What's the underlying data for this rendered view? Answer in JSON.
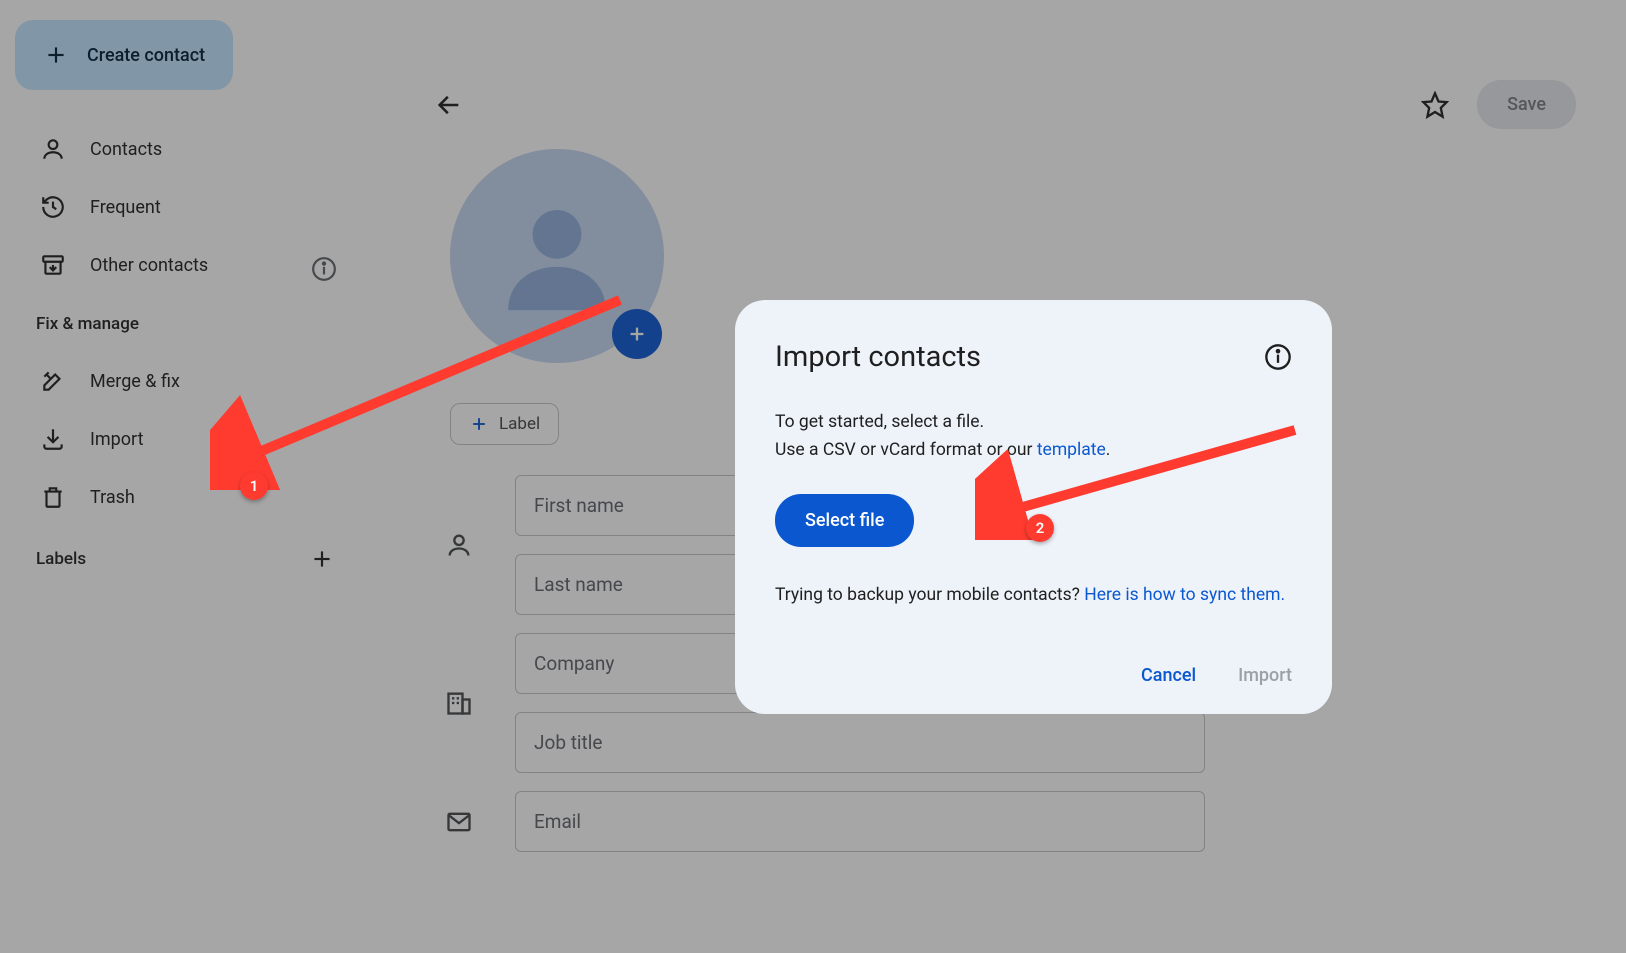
{
  "sidebar": {
    "create_label": "Create contact",
    "items": [
      {
        "label": "Contacts"
      },
      {
        "label": "Frequent"
      },
      {
        "label": "Other contacts"
      }
    ],
    "section1": "Fix & manage",
    "fix_items": [
      {
        "label": "Merge & fix"
      },
      {
        "label": "Import"
      },
      {
        "label": "Trash"
      }
    ],
    "labels_header": "Labels"
  },
  "main": {
    "save_label": "Save",
    "label_chip": "Label",
    "fields": {
      "first_name": "First name",
      "last_name": "Last name",
      "company": "Company",
      "job_title": "Job title",
      "email": "Email"
    }
  },
  "dialog": {
    "title": "Import contacts",
    "line1": "To get started, select a file.",
    "line2_a": "Use a CSV or vCard format or our ",
    "line2_link": "template",
    "line2_b": ".",
    "select_file": "Select file",
    "backup_a": "Trying to backup your mobile contacts? ",
    "backup_link": "Here is how to sync them.",
    "cancel": "Cancel",
    "import": "Import"
  },
  "annotations": {
    "badge1": "1",
    "badge2": "2"
  }
}
